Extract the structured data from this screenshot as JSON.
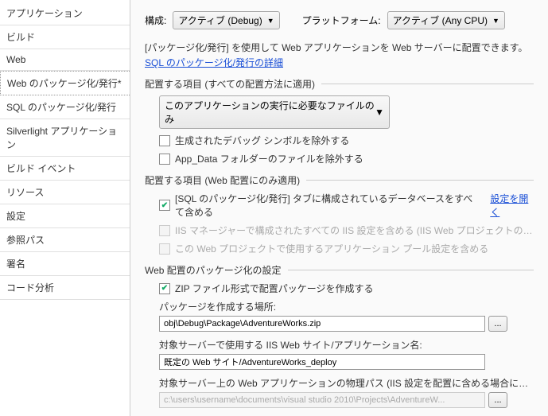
{
  "sidebar": {
    "items": [
      {
        "label": "アプリケーション"
      },
      {
        "label": "ビルド"
      },
      {
        "label": "Web"
      },
      {
        "label": "Web のパッケージ化/発行*"
      },
      {
        "label": "SQL のパッケージ化/発行"
      },
      {
        "label": "Silverlight アプリケーション"
      },
      {
        "label": "ビルド イベント"
      },
      {
        "label": "リソース"
      },
      {
        "label": "設定"
      },
      {
        "label": "参照パス"
      },
      {
        "label": "署名"
      },
      {
        "label": "コード分析"
      }
    ]
  },
  "top": {
    "config_label": "構成:",
    "config_value": "アクティブ (Debug)",
    "platform_label": "プラットフォーム:",
    "platform_value": "アクティブ (Any CPU)"
  },
  "intro": {
    "text": "[パッケージ化/発行] を使用して Web アプリケーションを Web サーバーに配置できます。",
    "link": "SQL のパッケージ化/発行の詳細"
  },
  "section1": {
    "title": "配置する項目 (すべての配置方法に適用)",
    "dropdown": "このアプリケーションの実行に必要なファイルのみ",
    "cb1": "生成されたデバッグ シンボルを除外する",
    "cb2": "App_Data フォルダーのファイルを除外する"
  },
  "section2": {
    "title": "配置する項目 (Web 配置にのみ適用)",
    "cb1": "[SQL のパッケージ化/発行] タブに構成されているデータベースをすべて含める",
    "open_link": "設定を開く",
    "cb2": "IIS マネージャーで構成されたすべての IIS 設定を含める (IIS Web プロジェクトの場合にのみ使用...",
    "cb3": "この Web プロジェクトで使用するアプリケーション プール設定を含める"
  },
  "section3": {
    "title": "Web 配置のパッケージ化の設定",
    "cb1": "ZIP ファイル形式で配置パッケージを作成する",
    "loc_label": "パッケージを作成する場所:",
    "loc_value": "obj\\Debug\\Package\\AdventureWorks.zip",
    "site_label": "対象サーバーで使用する IIS Web サイト/アプリケーション名:",
    "site_value": "既定の Web サイト/AdventureWorks_deploy",
    "phys_label": "対象サーバー上の Web アプリケーションの物理パス (IIS 設定を配置に含める場合にのみ使用...",
    "phys_value": "c:\\users\\username\\documents\\visual studio 2010\\Projects\\AdventureW...",
    "browse": "..."
  }
}
